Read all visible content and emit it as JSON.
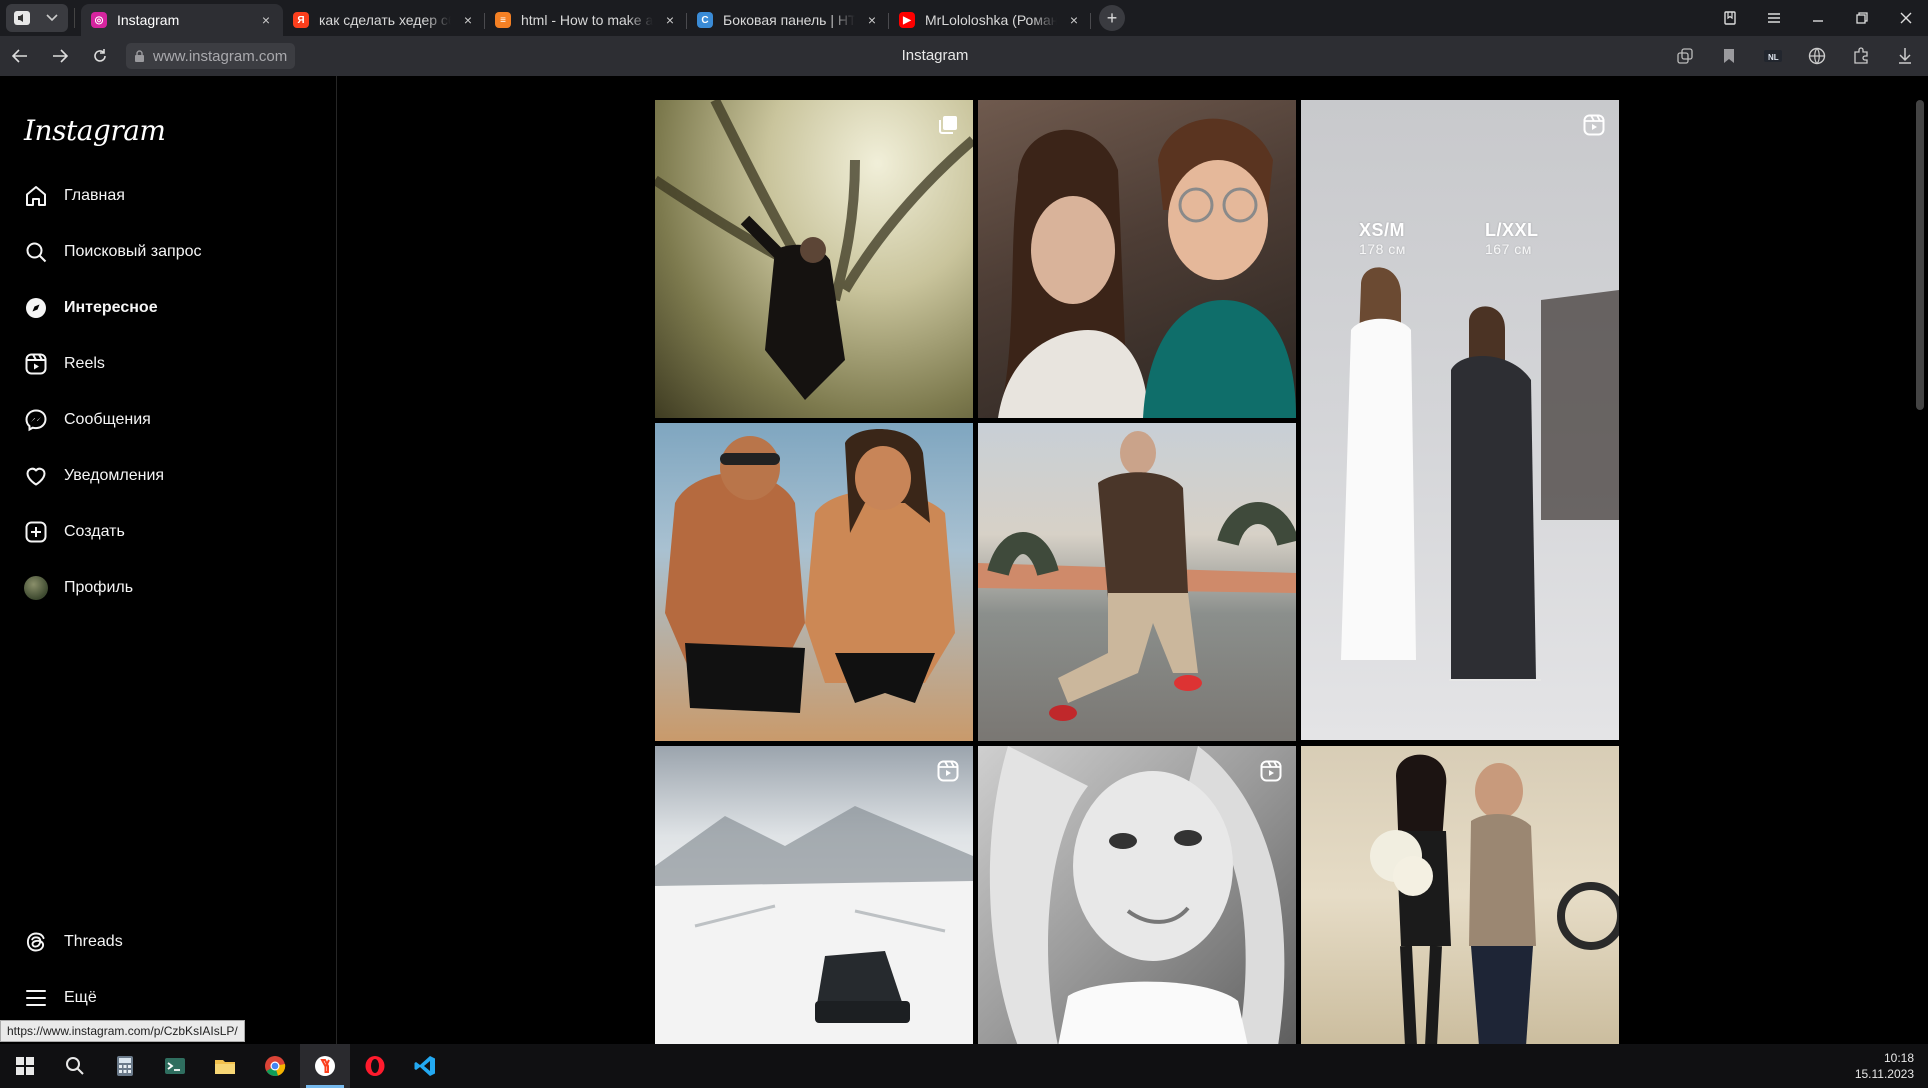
{
  "browser": {
    "tabs": [
      {
        "title": "Instagram",
        "favicon": "instagram-icon",
        "color": "#d6249f",
        "active": true,
        "glyph": "◎"
      },
      {
        "title": "как сделать хедер сбоку –",
        "favicon": "yandex-icon",
        "color": "#fc3f1d",
        "active": false,
        "glyph": "Я"
      },
      {
        "title": "html - How to make a page",
        "favicon": "stackoverflow-icon",
        "color": "#f48024",
        "active": false,
        "glyph": "≡"
      },
      {
        "title": "Боковая панель | HTML | С",
        "favicon": "webpage-icon",
        "color": "#3a8bd6",
        "active": false,
        "glyph": "C"
      },
      {
        "title": "MrLololoshka (Роман",
        "favicon": "youtube-icon",
        "color": "#ff0000",
        "active": false,
        "glyph": "▶"
      }
    ],
    "url": "www.instagram.com",
    "page_title": "Instagram"
  },
  "sidebar": {
    "logo": "Instagram",
    "items": [
      {
        "label": "Главная",
        "icon": "home-icon",
        "bold": false
      },
      {
        "label": "Поисковый запрос",
        "icon": "search-icon",
        "bold": false
      },
      {
        "label": "Интересное",
        "icon": "compass-icon",
        "bold": true
      },
      {
        "label": "Reels",
        "icon": "reels-icon",
        "bold": false
      },
      {
        "label": "Сообщения",
        "icon": "messenger-icon",
        "bold": false
      },
      {
        "label": "Уведомления",
        "icon": "heart-icon",
        "bold": false
      },
      {
        "label": "Создать",
        "icon": "plus-square-icon",
        "bold": false
      },
      {
        "label": "Профиль",
        "icon": "avatar",
        "bold": false
      }
    ],
    "bottom": [
      {
        "label": "Threads",
        "icon": "threads-icon"
      },
      {
        "label": "Ещё",
        "icon": "menu-icon"
      }
    ]
  },
  "explore": {
    "posts": [
      {
        "badge": "carousel-icon",
        "caption": "",
        "caption_sub": ""
      },
      {
        "badge": "",
        "caption": "",
        "caption_sub": ""
      },
      {
        "badge": "reels-icon",
        "caption": "XS/M",
        "caption_sub": "178 см",
        "caption2": "L/XXL",
        "caption2_sub": "167 см"
      },
      {
        "badge": "",
        "caption": "",
        "caption_sub": ""
      },
      {
        "badge": "",
        "caption": "",
        "caption_sub": ""
      },
      {
        "badge": "reels-icon",
        "caption": "",
        "caption_sub": ""
      },
      {
        "badge": "reels-icon",
        "caption": "",
        "caption_sub": ""
      },
      {
        "badge": "",
        "caption": "",
        "caption_sub": ""
      }
    ]
  },
  "status_bar": {
    "link": "https://www.instagram.com/p/CzbKsIAIsLP/"
  },
  "taskbar": {
    "apps": [
      "windows-start-icon",
      "search-icon",
      "calculator-icon",
      "terminal-icon",
      "file-explorer-icon",
      "chrome-icon",
      "yandex-browser-icon",
      "opera-icon",
      "vscode-icon"
    ],
    "time": "10:18",
    "date": "15.11.2023"
  }
}
